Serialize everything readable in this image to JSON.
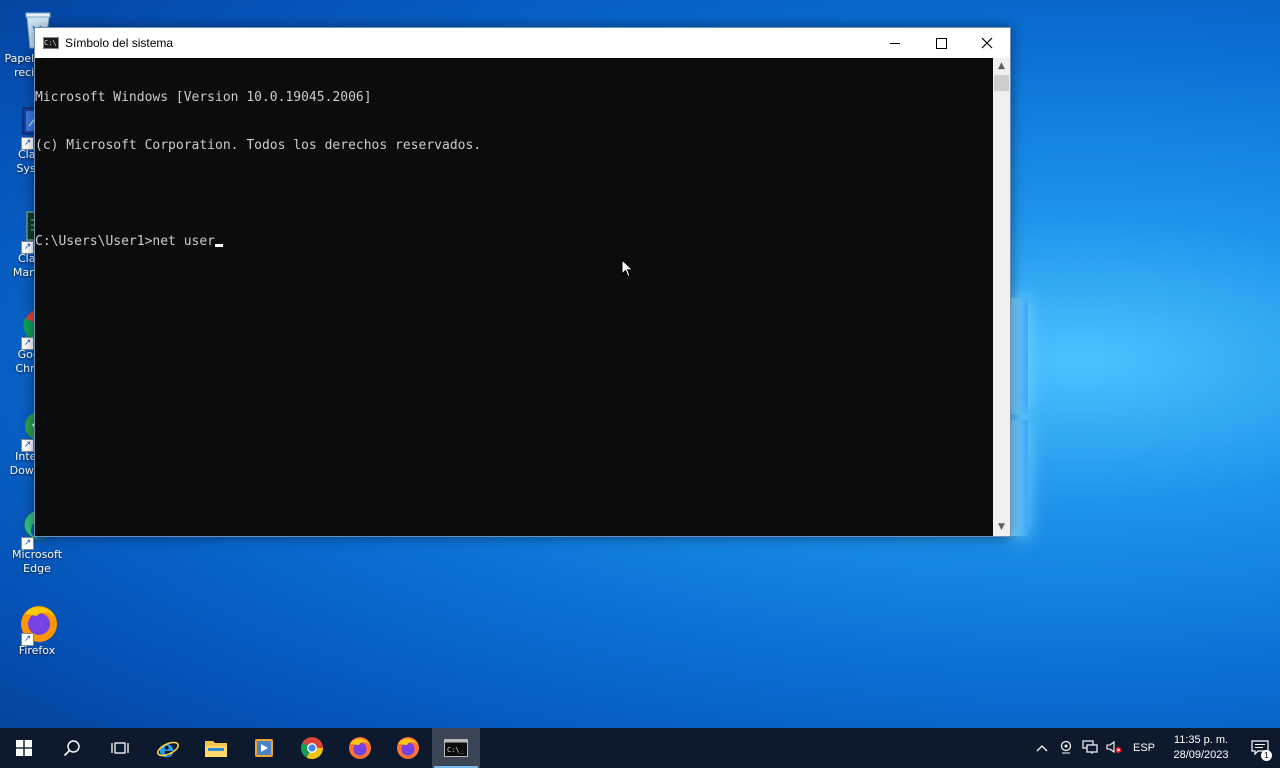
{
  "desktop": {
    "icons": [
      {
        "label": "Papelera de reciclaje",
        "icon": "recycle-bin-icon"
      },
      {
        "label": "Classic System",
        "icon": "monitor-icon"
      },
      {
        "label": "Classic Manager",
        "icon": "terminal-app-icon"
      },
      {
        "label": "Google Chrome",
        "icon": "chrome-icon"
      },
      {
        "label": "Internet Download",
        "icon": "download-manager-icon"
      },
      {
        "label": "Microsoft Edge",
        "icon": "edge-icon"
      },
      {
        "label": "Firefox",
        "icon": "firefox-icon"
      }
    ]
  },
  "window": {
    "title": "Símbolo del sistema",
    "console_lines": [
      "Microsoft Windows [Version 10.0.19045.2006]",
      "(c) Microsoft Corporation. Todos los derechos reservados.",
      "",
      "C:\\Users\\User1>net user"
    ]
  },
  "taskbar": {
    "apps": [
      "start-icon",
      "search-icon",
      "task-view-icon",
      "internet-explorer-icon",
      "file-explorer-icon",
      "media-player-icon",
      "chrome-icon",
      "firefox-icon",
      "firefox-icon",
      "cmd-icon"
    ],
    "active_app": "cmd-icon",
    "tray": {
      "language": "ESP",
      "time": "11:35 p. m.",
      "date": "28/09/2023",
      "notification_count": "1"
    }
  },
  "colors": {
    "console_bg": "#0c0c0c",
    "console_fg": "#cccccc",
    "taskbar_bg": "#0d1a2e",
    "accent": "#76b9ed"
  }
}
